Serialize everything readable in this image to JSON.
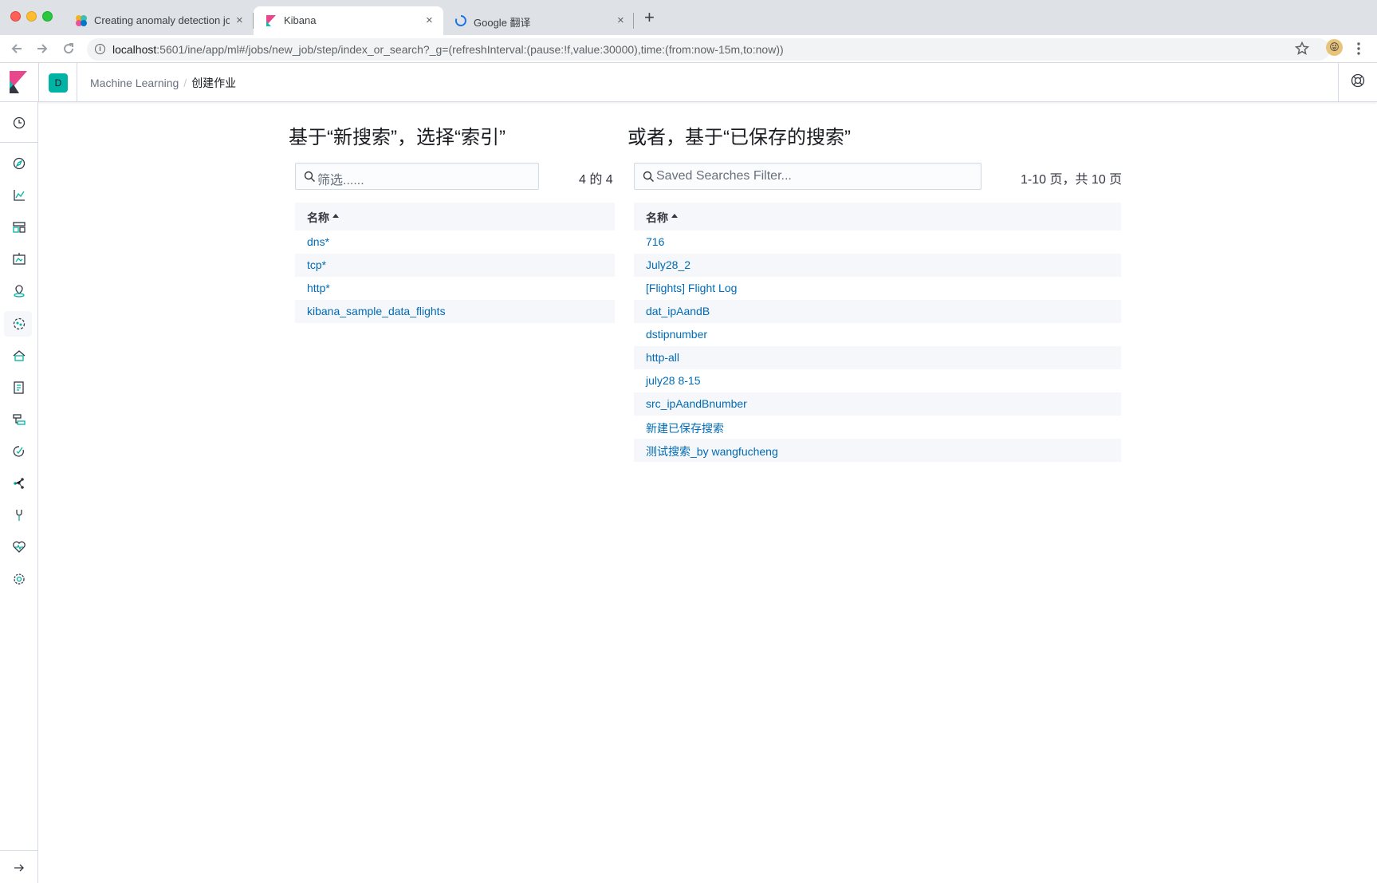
{
  "browser": {
    "tabs": [
      {
        "title": "Creating anomaly detection job",
        "active": false
      },
      {
        "title": "Kibana",
        "active": true
      },
      {
        "title": "Google 翻译",
        "active": false
      }
    ],
    "url_host": "localhost",
    "url_rest": ":5601/ine/app/ml#/jobs/new_job/step/index_or_search?_g=(refreshInterval:(pause:!f,value:30000),time:(from:now-15m,to:now))",
    "close_glyph": "×",
    "new_tab_glyph": "+"
  },
  "header": {
    "space_initial": "D",
    "breadcrumbs": [
      "Machine Learning",
      "创建作业"
    ],
    "breadcrumb_separator": "/"
  },
  "left_panel": {
    "title": "基于“新搜索”，选择“索引”",
    "search_placeholder": "筛选......",
    "count": "4 的 4",
    "column_header": "名称",
    "rows": [
      "dns*",
      "tcp*",
      "http*",
      "kibana_sample_data_flights"
    ]
  },
  "right_panel": {
    "title": "或者，基于“已保存的搜索”",
    "search_placeholder": "Saved Searches Filter...",
    "count": "1-10 页，共 10 页",
    "column_header": "名称",
    "rows": [
      "716",
      "July28_2",
      "[Flights] Flight Log",
      "dat_ipAandB",
      "dstipnumber",
      "http-all",
      "july28 8-15",
      "src_ipAandBnumber",
      "新建已保存搜索",
      "测试搜索_by wangfucheng"
    ]
  },
  "colors": {
    "link": "#006bb4",
    "accent_teal": "#00b3a4",
    "kibana_pink": "#e8488b",
    "row_alt": "#f5f7fa"
  },
  "sidenav_icons": [
    "recent-icon",
    "discover-icon",
    "visualize-icon",
    "dashboard-icon",
    "canvas-icon",
    "maps-icon",
    "machine-learning-icon",
    "infrastructure-icon",
    "logs-icon",
    "apm-icon",
    "uptime-icon",
    "graph-icon",
    "dev-tools-icon",
    "monitoring-icon",
    "management-icon",
    "expand-icon"
  ]
}
